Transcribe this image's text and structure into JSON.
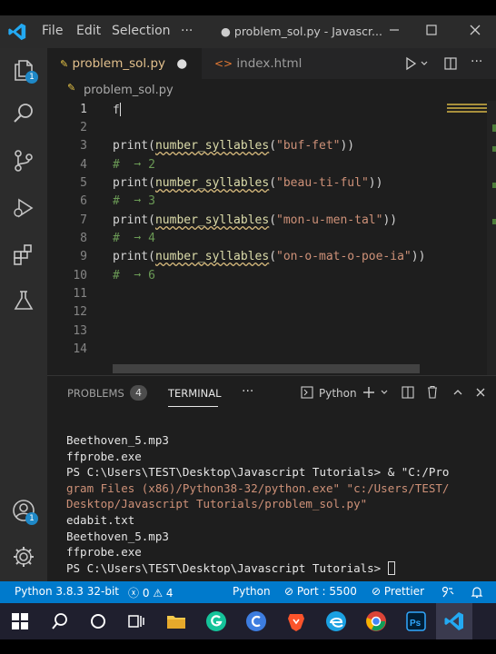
{
  "menu": {
    "file": "File",
    "edit": "Edit",
    "selection": "Selection",
    "more": "···"
  },
  "window_title": "● problem_sol.py - Javascr...",
  "tabs": [
    {
      "label": "problem_sol.py",
      "modified_dot": "●"
    },
    {
      "label": "index.html"
    }
  ],
  "breadcrumb": "problem_sol.py",
  "activity_badges": {
    "explorer": "1",
    "accounts": "1"
  },
  "editor": {
    "line_numbers": [
      "1",
      "2",
      "3",
      "4",
      "5",
      "6",
      "7",
      "8",
      "9",
      "10",
      "11",
      "12",
      "13",
      "14"
    ],
    "line1": "f",
    "calls": [
      {
        "pre": "print(",
        "fn": "number_syllables",
        "open": "(",
        "arg": "\"buf-fet\"",
        "close": "))"
      },
      {
        "pre": "print(",
        "fn": "number_syllables",
        "open": "(",
        "arg": "\"beau-ti-ful\"",
        "close": "))"
      },
      {
        "pre": "print(",
        "fn": "number_syllables",
        "open": "(",
        "arg": "\"mon-u-men-tal\"",
        "close": "))"
      },
      {
        "pre": "print(",
        "fn": "number_syllables",
        "open": "(",
        "arg": "\"on-o-mat-o-poe-ia\"",
        "close": "))"
      }
    ],
    "comments": [
      "#  ➞ 2",
      "#  ➞ 3",
      "#  ➞ 4",
      "#  ➞ 6"
    ]
  },
  "panel": {
    "problems_label": "PROBLEMS",
    "problems_count": "4",
    "terminal_label": "TERMINAL",
    "more": "···",
    "shell_label": "Python",
    "terminal_lines": [
      "Beethoven_5.mp3",
      "ffprobe.exe",
      "PS C:\\Users\\TEST\\Desktop\\Javascript Tutorials> & \"C:/Pro",
      "gram Files (x86)/Python38-32/python.exe\" \"c:/Users/TEST/",
      "Desktop/Javascript Tutorials/problem_sol.py\"",
      "edabit.txt",
      "Beethoven_5.mp3",
      "ffprobe.exe",
      "PS C:\\Users\\TEST\\Desktop\\Javascript Tutorials> "
    ]
  },
  "status": {
    "interpreter": "Python 3.8.3 32-bit",
    "errors": "0",
    "warnings": "4",
    "language": "Python",
    "port": "Port : 5500",
    "prettier": "Prettier"
  },
  "colors": {
    "accent": "#007acc",
    "modified_tab": "#e2c08d",
    "string": "#ce9178",
    "function": "#dcdcaa",
    "comment": "#6a9955"
  }
}
